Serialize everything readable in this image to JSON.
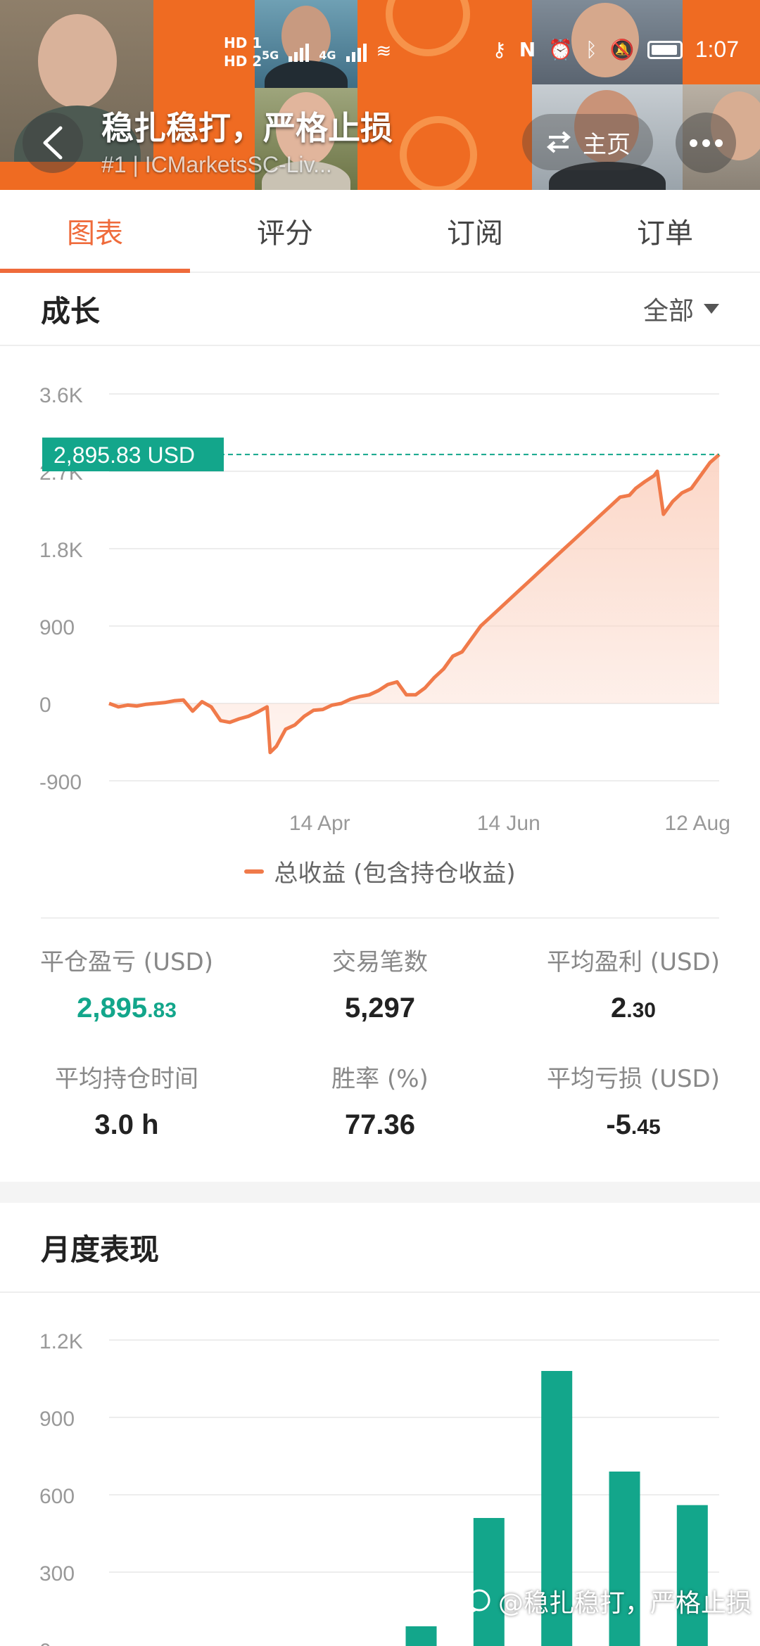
{
  "status_bar": {
    "sim1": "HD 1",
    "sim2": "HD 2",
    "net1": "5G",
    "net2": "4G",
    "time": "1:07"
  },
  "header": {
    "title": "稳扎稳打，严格止损",
    "subtitle": "#1 | ICMarketsSC-Liv...",
    "home_label": "主页"
  },
  "tabs": [
    {
      "label": "图表",
      "active": true
    },
    {
      "label": "评分",
      "active": false
    },
    {
      "label": "订阅",
      "active": false
    },
    {
      "label": "订单",
      "active": false
    }
  ],
  "growth": {
    "title": "成长",
    "filter": "全部",
    "current_label": "2,895.83 USD",
    "legend": "总收益 (包含持仓收益)"
  },
  "growth_chart": {
    "type": "area",
    "y_ticks": [
      "3.6K",
      "2.7K",
      "1.8K",
      "900",
      "0",
      "-900"
    ],
    "x_ticks": [
      "14 Apr",
      "14 Jun",
      "12 Aug"
    ],
    "ylim": [
      -900,
      3600
    ],
    "current_value": 2895.83,
    "line_color": "#f07a4a",
    "fill_color": "#fbd5c5",
    "ref_line_color": "#13a68b",
    "points": [
      [
        0,
        0
      ],
      [
        3,
        -40
      ],
      [
        6,
        -20
      ],
      [
        9,
        -30
      ],
      [
        12,
        -10
      ],
      [
        15,
        0
      ],
      [
        18,
        10
      ],
      [
        21,
        30
      ],
      [
        24,
        40
      ],
      [
        27,
        -90
      ],
      [
        30,
        20
      ],
      [
        33,
        -40
      ],
      [
        36,
        -200
      ],
      [
        39,
        -220
      ],
      [
        42,
        -180
      ],
      [
        45,
        -150
      ],
      [
        48,
        -100
      ],
      [
        51,
        -40
      ],
      [
        52,
        -570
      ],
      [
        54,
        -500
      ],
      [
        57,
        -300
      ],
      [
        60,
        -250
      ],
      [
        63,
        -150
      ],
      [
        66,
        -80
      ],
      [
        69,
        -70
      ],
      [
        72,
        -20
      ],
      [
        75,
        0
      ],
      [
        78,
        50
      ],
      [
        81,
        80
      ],
      [
        84,
        100
      ],
      [
        87,
        150
      ],
      [
        90,
        220
      ],
      [
        93,
        250
      ],
      [
        96,
        100
      ],
      [
        99,
        100
      ],
      [
        102,
        180
      ],
      [
        105,
        300
      ],
      [
        108,
        400
      ],
      [
        111,
        550
      ],
      [
        114,
        600
      ],
      [
        117,
        750
      ],
      [
        120,
        900
      ],
      [
        123,
        1000
      ],
      [
        126,
        1100
      ],
      [
        129,
        1200
      ],
      [
        132,
        1300
      ],
      [
        135,
        1400
      ],
      [
        138,
        1500
      ],
      [
        141,
        1600
      ],
      [
        144,
        1700
      ],
      [
        147,
        1800
      ],
      [
        150,
        1900
      ],
      [
        153,
        2000
      ],
      [
        156,
        2100
      ],
      [
        159,
        2200
      ],
      [
        162,
        2300
      ],
      [
        165,
        2400
      ],
      [
        168,
        2420
      ],
      [
        170,
        2500
      ],
      [
        173,
        2580
      ],
      [
        176,
        2650
      ],
      [
        177,
        2700
      ],
      [
        179,
        2200
      ],
      [
        182,
        2350
      ],
      [
        185,
        2450
      ],
      [
        188,
        2500
      ],
      [
        191,
        2650
      ],
      [
        194,
        2800
      ],
      [
        197,
        2895.83
      ]
    ],
    "x_tick_positions": [
      68,
      129,
      190
    ]
  },
  "stats": [
    {
      "label": "平仓盈亏 (USD)",
      "value_main": "2,895",
      "value_frac": ".83",
      "green": true
    },
    {
      "label": "交易笔数",
      "value_main": "5,297",
      "value_frac": "",
      "green": false
    },
    {
      "label": "平均盈利 (USD)",
      "value_main": "2",
      "value_frac": ".30",
      "green": false
    },
    {
      "label": "平均持仓时间",
      "value_main": "3.0 h",
      "value_frac": "",
      "green": false
    },
    {
      "label": "胜率 (%)",
      "value_main": "77.36",
      "value_frac": "",
      "green": false
    },
    {
      "label": "平均亏损 (USD)",
      "value_main": "-5",
      "value_frac": ".45",
      "green": false
    }
  ],
  "monthly": {
    "title": "月度表现"
  },
  "chart_data": {
    "type": "bar",
    "y_ticks": [
      "1.2K",
      "900",
      "600",
      "300",
      "0"
    ],
    "ylim": [
      0,
      1200
    ],
    "color": "#13a68b",
    "values": [
      0,
      0,
      0,
      10,
      90,
      510,
      1080,
      690,
      560
    ]
  },
  "watermark": {
    "text": "@稳扎稳打，严格止损"
  }
}
